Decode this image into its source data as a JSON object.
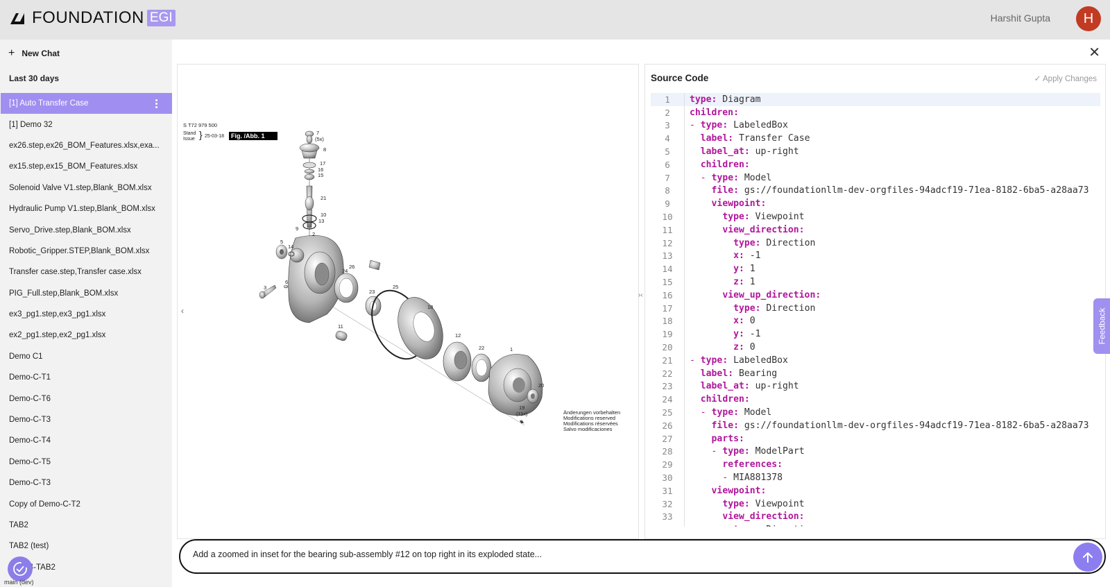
{
  "header": {
    "brand_name": "FOUNDATION",
    "brand_badge": "EGI",
    "user_name": "Harshit Gupta",
    "avatar_initial": "H"
  },
  "sidebar": {
    "new_chat_label": "New Chat",
    "section_label": "Last 30 days",
    "active_index": 0,
    "items": [
      "[1] Auto Transfer Case",
      "[1] Demo 32",
      "ex26.step,ex26_BOM_Features.xlsx,exa...",
      "ex15.step,ex15_BOM_Features.xlsx",
      "Solenoid Valve V1.step,Blank_BOM.xlsx",
      "Hydraulic Pump V1.step,Blank_BOM.xlsx",
      "Servo_Drive.step,Blank_BOM.xlsx",
      "Robotic_Gripper.STEP,Blank_BOM.xlsx",
      "Transfer case.step,Transfer case.xlsx",
      "PIG_Full.step,Blank_BOM.xlsx",
      "ex3_pg1.step,ex3_pg1.xlsx",
      "ex2_pg1.step,ex2_pg1.xlsx",
      "Demo C1",
      "Demo-C-T1",
      "Demo-C-T6",
      "Demo-C-T3",
      "Demo-C-T4",
      "Demo-C-T5",
      "Demo-C-T3",
      "Copy of Demo-C-T2",
      "TAB2",
      "TAB2 (test)",
      "...2064-TAB2"
    ],
    "branch_label": "main (dev)"
  },
  "diagram": {
    "part_number": "S T72 979 500",
    "stand": "Stand",
    "issue": "Issue",
    "date": "25-03-18",
    "fig_label": "Fig. /Abb. 1",
    "notes": [
      "Änderungen vorbehalten",
      "Modifications reserved",
      "Modifications réservées",
      "Salvo modificaciones"
    ],
    "callouts": {
      "c7": "7",
      "c5x": "(5x)",
      "c8": "8",
      "c17": "17",
      "c16": "16",
      "c15": "15",
      "c21": "21",
      "c10": "10",
      "c13": "13",
      "c9": "9",
      "c2": "2",
      "c5": "5",
      "c14": "14",
      "c3": "3",
      "c6": "6",
      "c24": "24",
      "c26": "26",
      "c23": "23",
      "c25": "25",
      "c18": "18",
      "c11": "11",
      "c12": "12",
      "c22": "22",
      "c1": "1",
      "c20": "20",
      "c19": "19",
      "c11x": "(11x)"
    }
  },
  "code_panel": {
    "title": "Source Code",
    "apply_label": "Apply Changes",
    "lines": [
      {
        "indent": 0,
        "dash": false,
        "key": "type",
        "value": "Diagram"
      },
      {
        "indent": 0,
        "dash": false,
        "key": "children",
        "value": ""
      },
      {
        "indent": 0,
        "dash": true,
        "key": "type",
        "value": "LabeledBox"
      },
      {
        "indent": 1,
        "dash": false,
        "key": "label",
        "value": "Transfer Case"
      },
      {
        "indent": 1,
        "dash": false,
        "key": "label_at",
        "value": "up-right"
      },
      {
        "indent": 1,
        "dash": false,
        "key": "children",
        "value": ""
      },
      {
        "indent": 1,
        "dash": true,
        "key": "type",
        "value": "Model"
      },
      {
        "indent": 2,
        "dash": false,
        "key": "file",
        "value": "gs://foundationllm-dev-orgfiles-94adcf19-71ea-8182-6ba5-a28aa73"
      },
      {
        "indent": 2,
        "dash": false,
        "key": "viewpoint",
        "value": ""
      },
      {
        "indent": 3,
        "dash": false,
        "key": "type",
        "value": "Viewpoint"
      },
      {
        "indent": 3,
        "dash": false,
        "key": "view_direction",
        "value": ""
      },
      {
        "indent": 4,
        "dash": false,
        "key": "type",
        "value": "Direction"
      },
      {
        "indent": 4,
        "dash": false,
        "key": "x",
        "value": "-1"
      },
      {
        "indent": 4,
        "dash": false,
        "key": "y",
        "value": "1"
      },
      {
        "indent": 4,
        "dash": false,
        "key": "z",
        "value": "1"
      },
      {
        "indent": 3,
        "dash": false,
        "key": "view_up_direction",
        "value": ""
      },
      {
        "indent": 4,
        "dash": false,
        "key": "type",
        "value": "Direction"
      },
      {
        "indent": 4,
        "dash": false,
        "key": "x",
        "value": "0"
      },
      {
        "indent": 4,
        "dash": false,
        "key": "y",
        "value": "-1"
      },
      {
        "indent": 4,
        "dash": false,
        "key": "z",
        "value": "0"
      },
      {
        "indent": 0,
        "dash": true,
        "key": "type",
        "value": "LabeledBox"
      },
      {
        "indent": 1,
        "dash": false,
        "key": "label",
        "value": "Bearing"
      },
      {
        "indent": 1,
        "dash": false,
        "key": "label_at",
        "value": "up-right"
      },
      {
        "indent": 1,
        "dash": false,
        "key": "children",
        "value": ""
      },
      {
        "indent": 1,
        "dash": true,
        "key": "type",
        "value": "Model"
      },
      {
        "indent": 2,
        "dash": false,
        "key": "file",
        "value": "gs://foundationllm-dev-orgfiles-94adcf19-71ea-8182-6ba5-a28aa73"
      },
      {
        "indent": 2,
        "dash": false,
        "key": "parts",
        "value": ""
      },
      {
        "indent": 2,
        "dash": true,
        "key": "type",
        "value": "ModelPart"
      },
      {
        "indent": 3,
        "dash": false,
        "key": "references",
        "value": ""
      },
      {
        "indent": 3,
        "dash": true,
        "key": "",
        "value": "MIA881378"
      },
      {
        "indent": 2,
        "dash": false,
        "key": "viewpoint",
        "value": ""
      },
      {
        "indent": 3,
        "dash": false,
        "key": "type",
        "value": "Viewpoint"
      },
      {
        "indent": 3,
        "dash": false,
        "key": "view_direction",
        "value": ""
      },
      {
        "indent": 4,
        "dash": false,
        "key": "type",
        "value": "Direction"
      }
    ]
  },
  "feedback_label": "Feedback",
  "chat_input": {
    "value": "Add a zoomed in inset for the bearing sub-assembly #12 on top right in its exploded state..."
  }
}
